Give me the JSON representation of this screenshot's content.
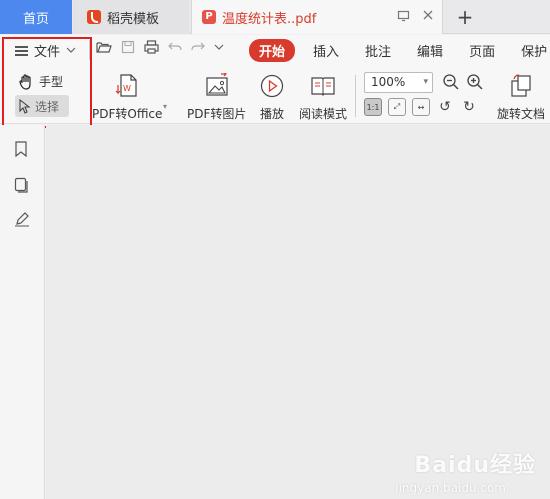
{
  "tabs": {
    "home": "首页",
    "daoke": "稻壳模板",
    "pdf": "温度统计表..pdf",
    "new_tab": "+"
  },
  "toolbar": {
    "file_menu": "文件",
    "ribbon_tabs": [
      "开始",
      "插入",
      "批注",
      "编辑",
      "页面",
      "保护"
    ],
    "hand": "手型",
    "select": "选择",
    "pdf_to_office": "PDF转Office",
    "pdf_to_image": "PDF转图片",
    "play": "播放",
    "read_mode": "阅读模式",
    "zoom": "100%",
    "rotate": "旋转文档"
  },
  "watermark": {
    "brand": "Baidu经验",
    "url": "jingyan.baidu.com"
  }
}
